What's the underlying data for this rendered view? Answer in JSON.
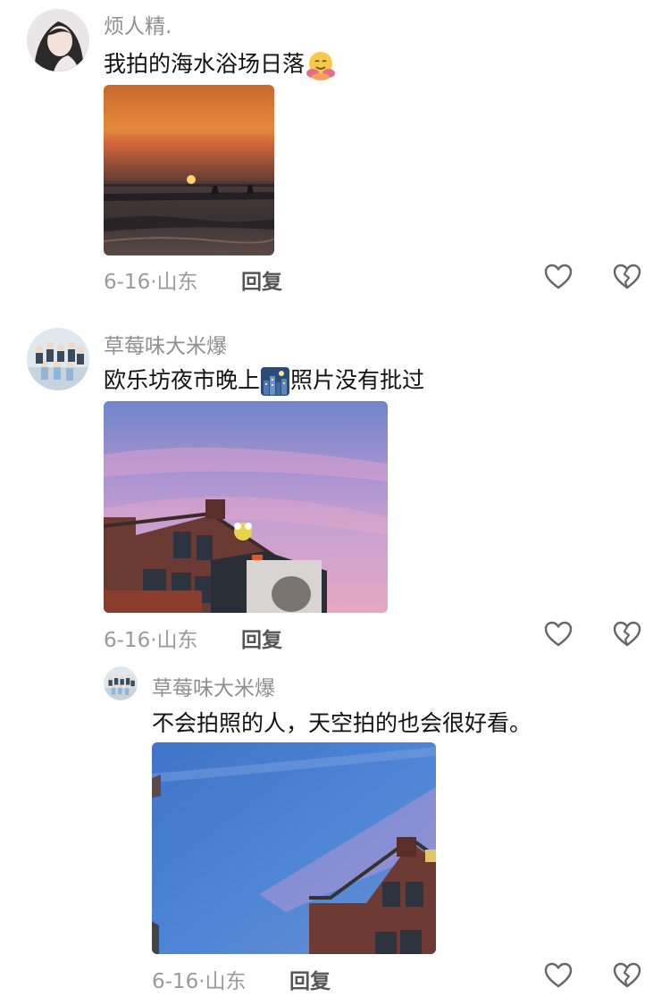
{
  "comments": [
    {
      "username": "烦人精.",
      "text": "我拍的海水浴场日落",
      "emoji": "hug-emoji",
      "date": "6-16",
      "location": "山东",
      "reply_label": "回复"
    },
    {
      "username": "草莓味大米爆",
      "text_before": "欧乐坊夜市晚上",
      "emoji": "night-city-emoji",
      "text_after": "照片没有批过",
      "date": "6-16",
      "location": "山东",
      "reply_label": "回复"
    },
    {
      "username": "草莓味大米爆",
      "text": "不会拍照的人，天空拍的也会很好看。",
      "date": "6-16",
      "location": "山东",
      "reply_label": "回复"
    }
  ],
  "separator": "·",
  "icons": {
    "like": "heart-outline-icon",
    "dislike": "broken-heart-outline-icon"
  },
  "colors": {
    "meta": "#9a9a9e",
    "username": "#8e8e93",
    "text": "#111111"
  }
}
